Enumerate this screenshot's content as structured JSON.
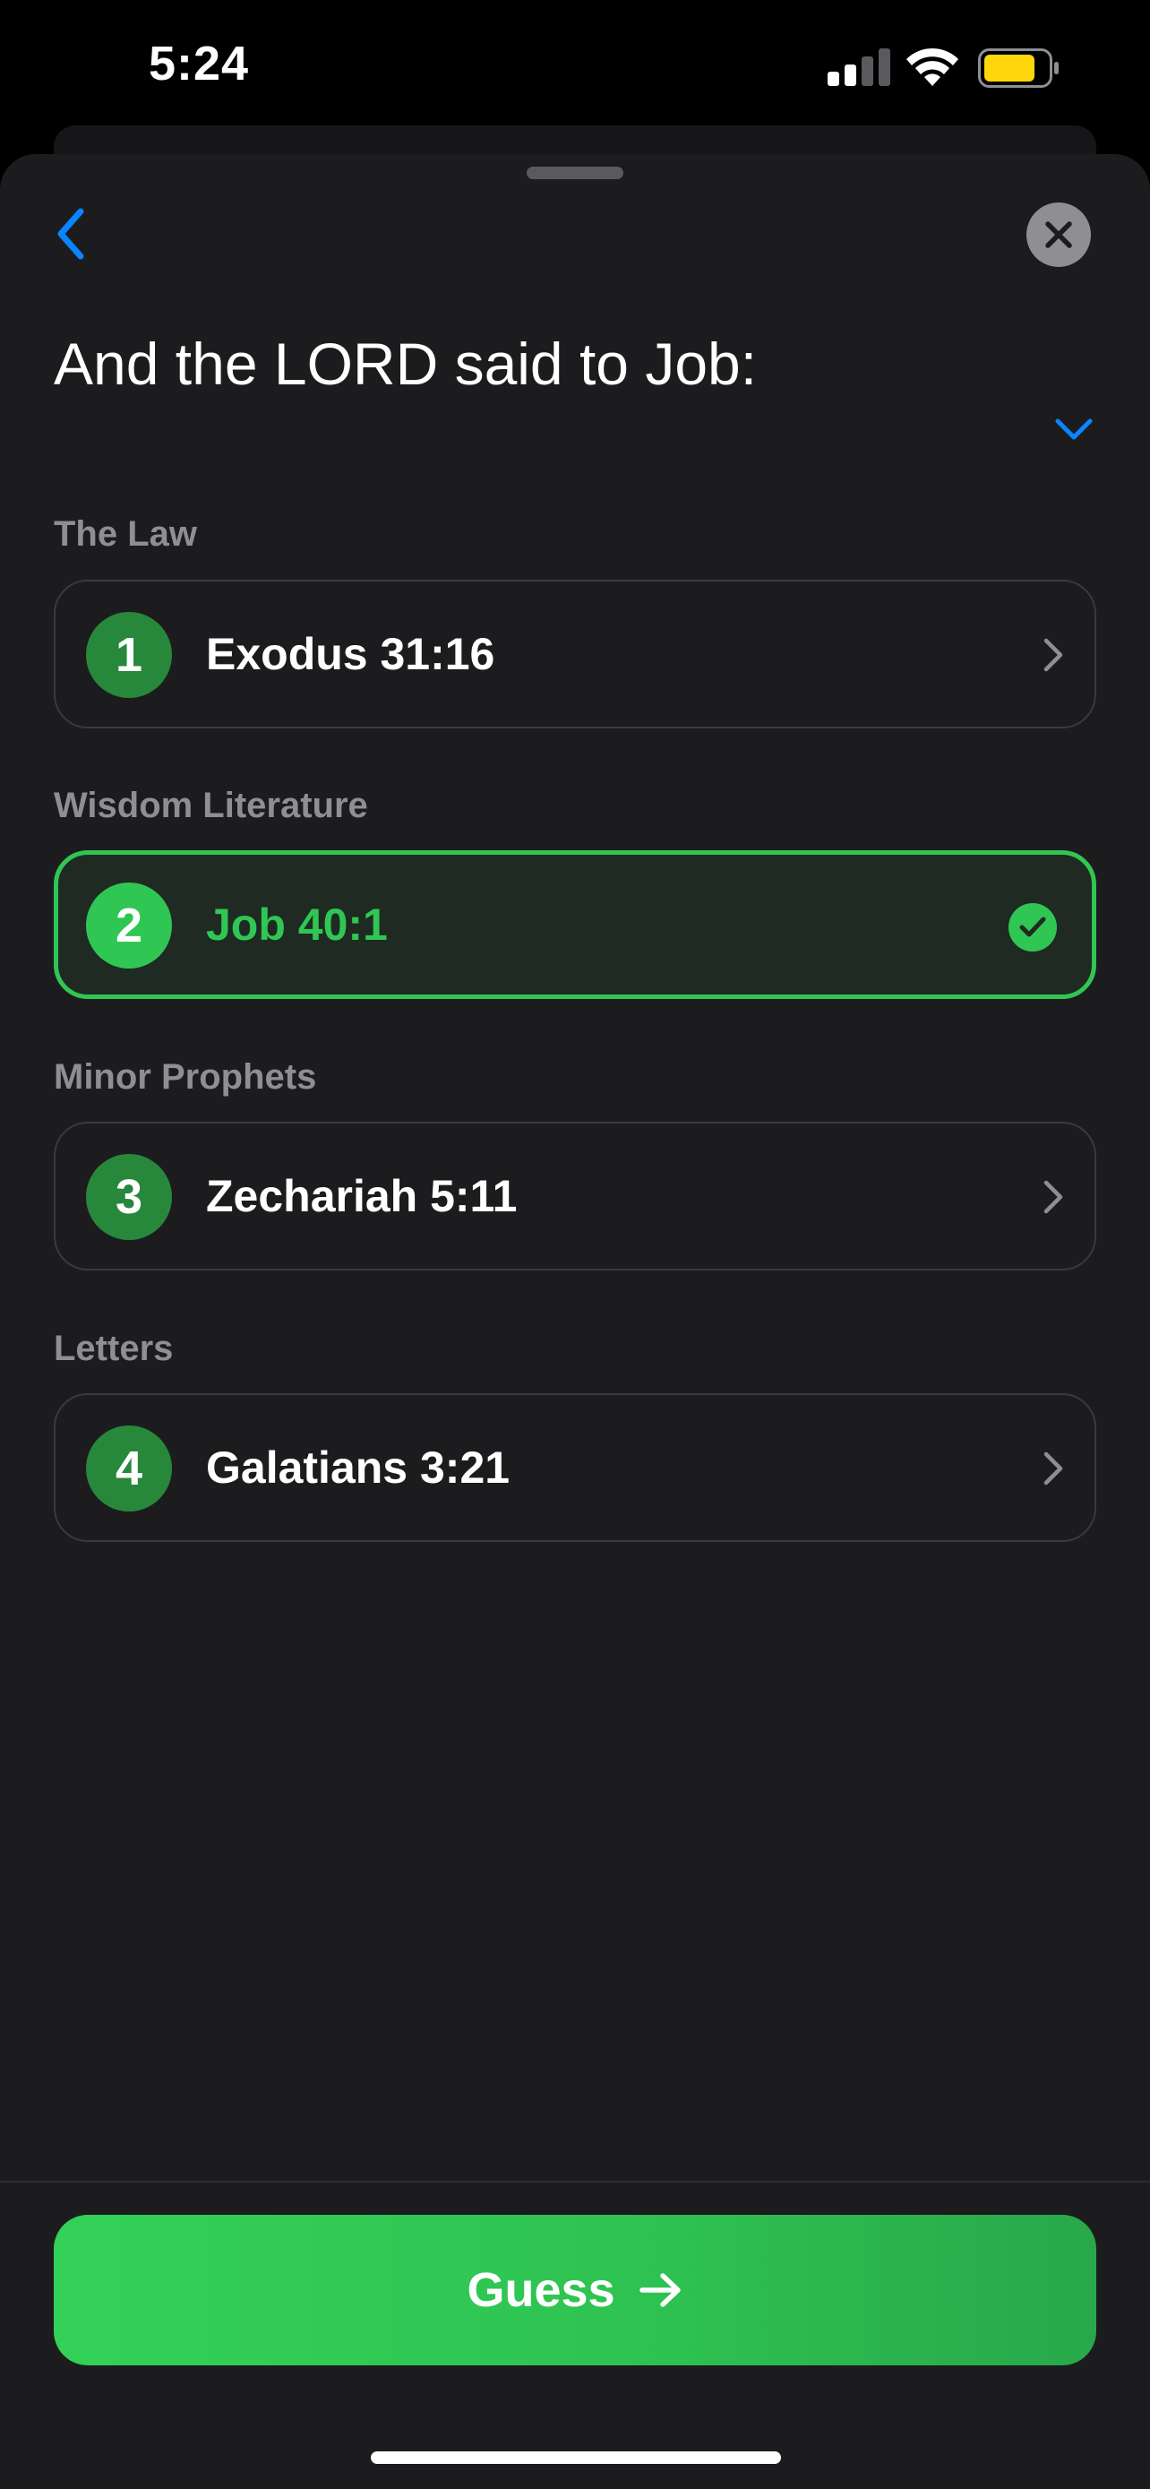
{
  "status_bar": {
    "time": "5:24"
  },
  "header": {
    "title": "And the LORD said to Job:"
  },
  "sections": [
    {
      "label": "The Law",
      "number": "1",
      "reference": "Exodus 31:16",
      "state": "default"
    },
    {
      "label": "Wisdom Literature",
      "number": "2",
      "reference": "Job 40:1",
      "state": "correct"
    },
    {
      "label": "Minor Prophets",
      "number": "3",
      "reference": "Zechariah 5:11",
      "state": "default"
    },
    {
      "label": "Letters",
      "number": "4",
      "reference": "Galatians 3:21",
      "state": "default"
    }
  ],
  "footer": {
    "guess_label": "Guess"
  },
  "icons": {
    "back": "chevron-left-icon",
    "close": "close-icon",
    "expand": "chevron-down-icon",
    "row_arrow": "chevron-right-icon",
    "correct": "checkmark-icon",
    "guess": "arrow-right-icon"
  },
  "colors": {
    "accent_blue": "#0a84ff",
    "correct_green": "#30c653",
    "badge_green": "#27883b",
    "battery_yellow": "#ffd60a"
  }
}
